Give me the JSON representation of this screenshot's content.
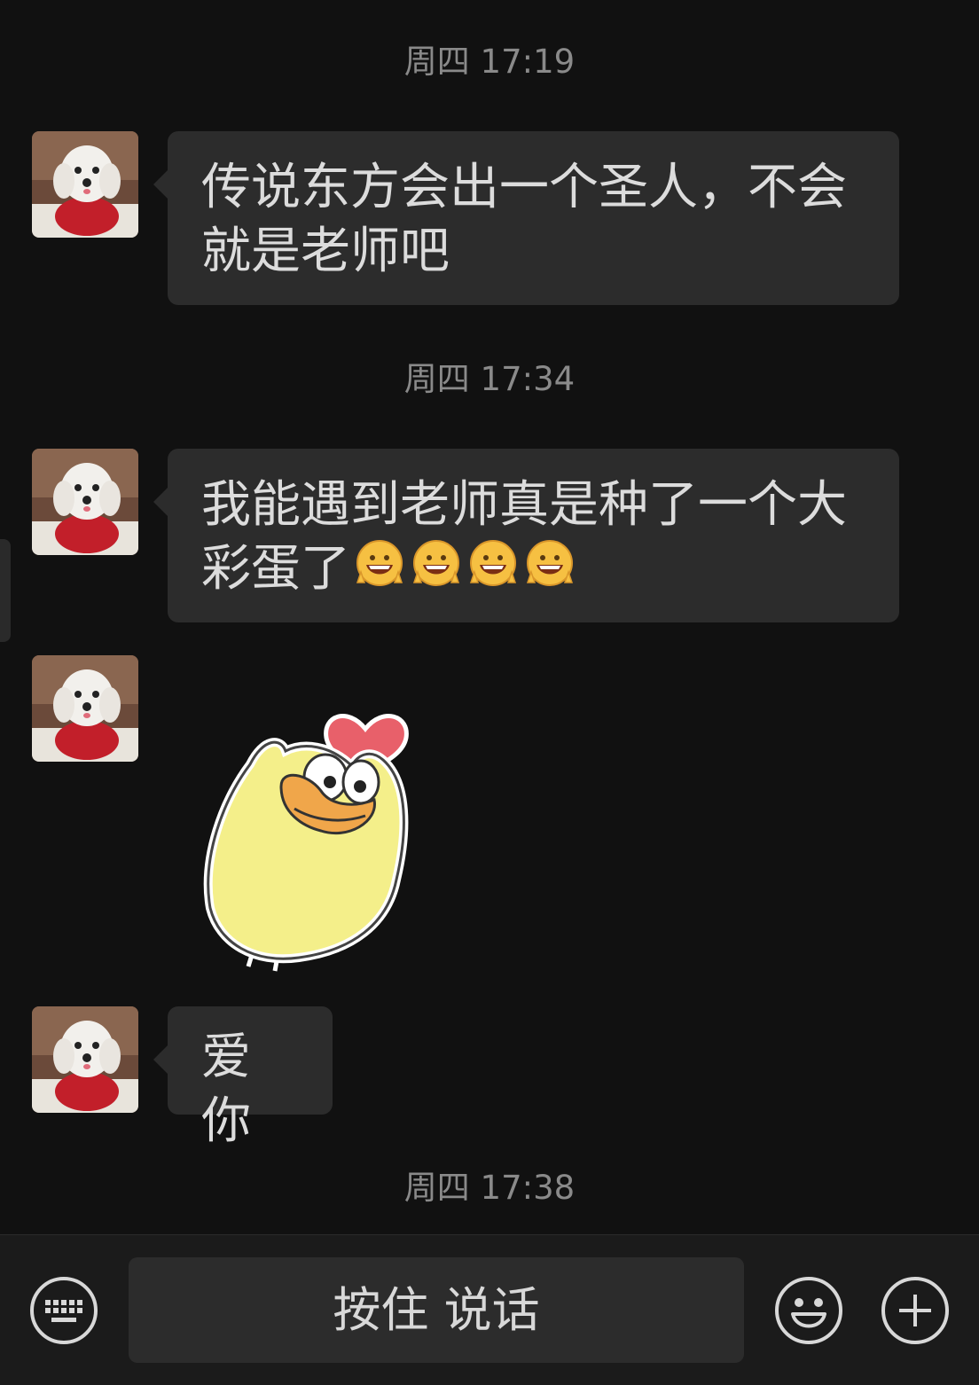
{
  "messages": [
    {
      "timestamp": "周四 17:19",
      "text": "传说东方会出一个圣人，不会就是老师吧"
    },
    {
      "timestamp": "周四 17:34",
      "text": "我能遇到老师真是种了一个大彩蛋了",
      "emoji_count": 4,
      "emoji": "grin-peace-emoji"
    },
    {
      "sticker": "yellow-duck-heart-sticker"
    },
    {
      "text": "爱你"
    },
    {
      "timestamp": "周四 17:38"
    }
  ],
  "input_bar": {
    "hold_to_talk_label": "按住 说话",
    "icons": [
      "keyboard-icon",
      "emoji-face-icon",
      "plus-icon"
    ]
  },
  "colors": {
    "background": "#111111",
    "bubble": "#2c2c2c",
    "text": "#dcdcdc",
    "timestamp": "#8a8a8a"
  }
}
